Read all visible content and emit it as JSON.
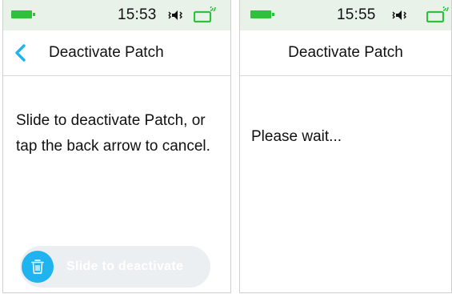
{
  "screens": [
    {
      "status": {
        "time": "15:53"
      },
      "header": {
        "title": "Deactivate Patch",
        "back_icon": "chevron-left-icon"
      },
      "body": {
        "instructions": "Slide to deactivate Patch, or tap the back arrow to cancel."
      },
      "slider": {
        "label": "Slide to deactivate",
        "knob_icon": "trash-icon"
      }
    },
    {
      "status": {
        "time": "15:55"
      },
      "header": {
        "title": "Deactivate Patch"
      },
      "body": {
        "message": "Please wait..."
      }
    }
  ],
  "colors": {
    "status_bar_bg": "#e9f2e9",
    "battery_green": "#2ec13a",
    "accent_blue": "#1fb4ef",
    "slider_track": "#eceff1"
  },
  "icons": [
    "battery-icon",
    "mute-icon",
    "pump-status-icon",
    "chevron-left-icon",
    "trash-icon"
  ]
}
